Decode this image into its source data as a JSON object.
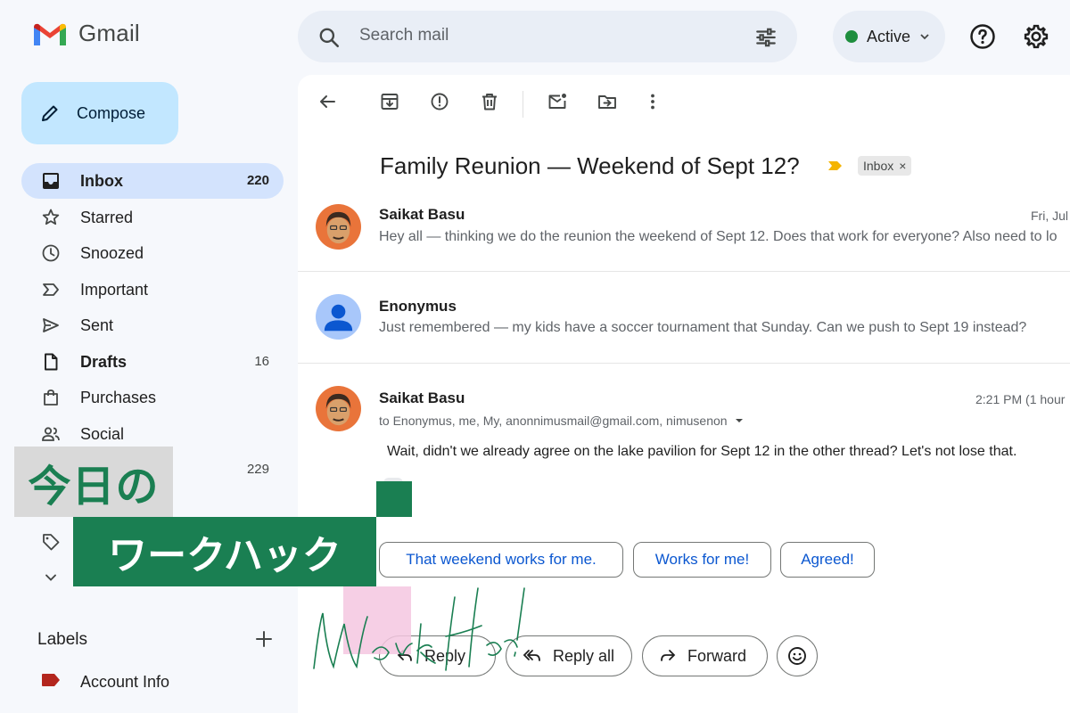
{
  "app": {
    "name": "Gmail"
  },
  "search": {
    "placeholder": "Search mail"
  },
  "status": {
    "label": "Active"
  },
  "compose": {
    "label": "Compose"
  },
  "nav": [
    {
      "name": "Inbox",
      "count": "220"
    },
    {
      "name": "Starred",
      "count": ""
    },
    {
      "name": "Snoozed",
      "count": ""
    },
    {
      "name": "Important",
      "count": ""
    },
    {
      "name": "Sent",
      "count": ""
    },
    {
      "name": "Drafts",
      "count": "16"
    },
    {
      "name": "Purchases",
      "count": ""
    },
    {
      "name": "Social",
      "count": ""
    },
    {
      "name": "",
      "count": "229"
    }
  ],
  "labels": {
    "title": "Labels",
    "items": [
      {
        "name": "Account Info",
        "color": "#b3261e"
      }
    ]
  },
  "thread": {
    "subject": "Family Reunion — Weekend of Sept 12?",
    "chip": "Inbox",
    "messages": [
      {
        "sender": "Saikat Basu",
        "time": "Fri, Jul",
        "snippet": "Hey all — thinking we do the reunion the weekend of Sept 12. Does that work for everyone? Also need to lo"
      },
      {
        "sender": "Enonymus",
        "snippet": "Just remembered — my kids have a soccer tournament that Sunday. Can we push to Sept 19 instead?"
      },
      {
        "sender": "Saikat Basu",
        "time": "2:21 PM (1 hour",
        "to": "to Enonymus, me, My, anonnimusmail@gmail.com, nimusenon",
        "body": "Wait, didn't we already agree on the lake pavilion for Sept 12 in the other thread? Let's not lose that."
      }
    ],
    "smart_replies": [
      "That weekend works for me.",
      "Works for me!",
      "Agreed!"
    ],
    "actions": {
      "reply": "Reply",
      "reply_all": "Reply all",
      "forward": "Forward"
    }
  },
  "overlay": {
    "line1": "今日の",
    "line2": "ワークハック",
    "script": "Work Hack!",
    "green": "#1a7f52",
    "pink": "#f4c7e0"
  }
}
